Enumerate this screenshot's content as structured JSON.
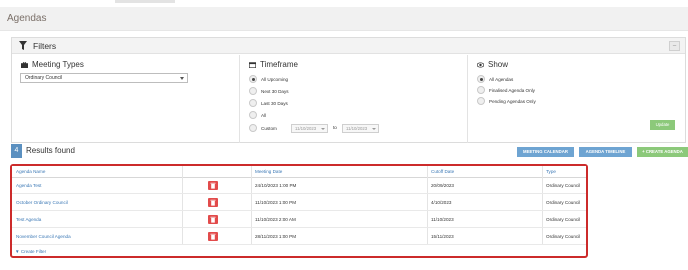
{
  "page": {
    "title": "Agendas"
  },
  "filters": {
    "title": "Filters",
    "meeting_types": {
      "title": "Meeting Types",
      "selected": "Ordinary Council"
    },
    "timeframe": {
      "title": "Timeframe",
      "options": [
        "All Upcoming",
        "Next 30 Days",
        "Last 30 Days",
        "All",
        "Custom"
      ],
      "selected": "All Upcoming",
      "custom_from": "11/10/2023",
      "custom_to": "11/10/2023",
      "to_label": "to"
    },
    "show": {
      "title": "Show",
      "options": [
        "All Agendas",
        "Finalised Agenda Only",
        "Pending Agendas Only"
      ],
      "selected": "All Agendas"
    },
    "update_label": "Update"
  },
  "results": {
    "count": "4",
    "label": "Results found",
    "buttons": {
      "calendar": "MEETING CALENDAR",
      "timeline": "AGENDA TIMELINE",
      "create": "+ CREATE AGENDA"
    }
  },
  "table": {
    "headers": {
      "name": "Agenda Name",
      "meeting_date": "Meeting Date",
      "cutoff_date": "Cutoff Date",
      "type": "Type"
    },
    "rows": [
      {
        "name": "Agenda Test",
        "meeting_date": "24/10/2023 1:00 PM",
        "cutoff_date": "20/09/2023",
        "type": "Ordinary Council"
      },
      {
        "name": "October Ordinary Council",
        "meeting_date": "11/10/2023 1:00 PM",
        "cutoff_date": "4/10/2023",
        "type": "Ordinary Council"
      },
      {
        "name": "Test Agenda",
        "meeting_date": "11/10/2023 2:00 AM",
        "cutoff_date": "11/10/2023",
        "type": "Ordinary Council"
      },
      {
        "name": "November Council Agenda",
        "meeting_date": "28/11/2023 1:00 PM",
        "cutoff_date": "15/11/2023",
        "type": "Ordinary Council"
      }
    ],
    "create_filter": "Create Filter"
  },
  "colors": {
    "accent_blue": "#6ea4d2",
    "accent_green": "#8cc97a",
    "delete_red": "#e24b4b",
    "highlight_red": "#cc2b2b"
  },
  "icons": {
    "filters": "funnel-icon",
    "meeting_types": "briefcase-icon",
    "timeframe": "calendar-icon",
    "show": "eye-icon",
    "delete": "trash-icon"
  }
}
